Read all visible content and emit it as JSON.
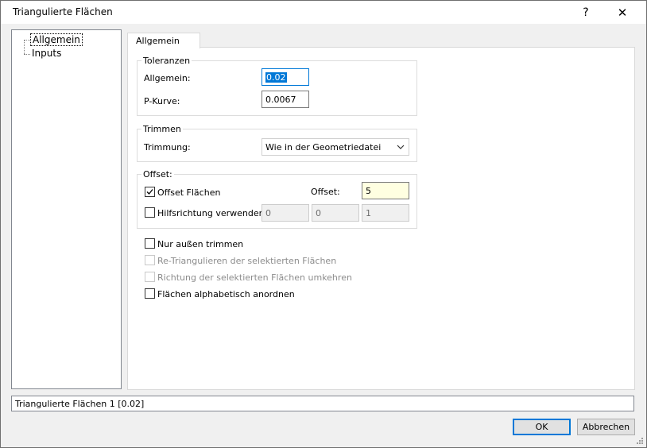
{
  "window": {
    "title": "Triangulierte Flächen",
    "help_label": "?",
    "close_label": "✕"
  },
  "tree": {
    "items": [
      {
        "label": "Allgemein"
      },
      {
        "label": "Inputs"
      }
    ]
  },
  "tab": {
    "label": "Allgemein"
  },
  "toleranzen": {
    "legend": "Toleranzen",
    "allgemein_label": "Allgemein:",
    "allgemein_value": "0.02",
    "pkurve_label": "P-Kurve:",
    "pkurve_value": "0.0067"
  },
  "trimmen": {
    "legend": "Trimmen",
    "trimmung_label": "Trimmung:",
    "trimmung_value": "Wie in der Geometriedatei"
  },
  "offset": {
    "legend": "Offset:",
    "offset_flaechen_label": "Offset Flächen",
    "offset_flaechen_checked": true,
    "offset_label": "Offset:",
    "offset_value": "5",
    "hilfsrichtung_label": "Hilfsrichtung verwenden:",
    "hilfsrichtung_checked": false,
    "hilfs_x": "0",
    "hilfs_y": "0",
    "hilfs_z": "1"
  },
  "options": {
    "nur_aussen": "Nur außen trimmen",
    "retriangulieren": "Re-Triangulieren der selektierten Flächen",
    "richtung": "Richtung der selektierten Flächen umkehren",
    "alphabetisch": "Flächen alphabetisch anordnen"
  },
  "status": {
    "text": "Triangulierte Flächen 1 [0.02]"
  },
  "buttons": {
    "ok": "OK",
    "abbrechen": "Abbrechen"
  },
  "colors": {
    "accent": "#0078d7",
    "highlight_field": "#ffffe1"
  },
  "icons": {
    "dropdown": "chevron-down-icon",
    "check": "check-icon"
  }
}
